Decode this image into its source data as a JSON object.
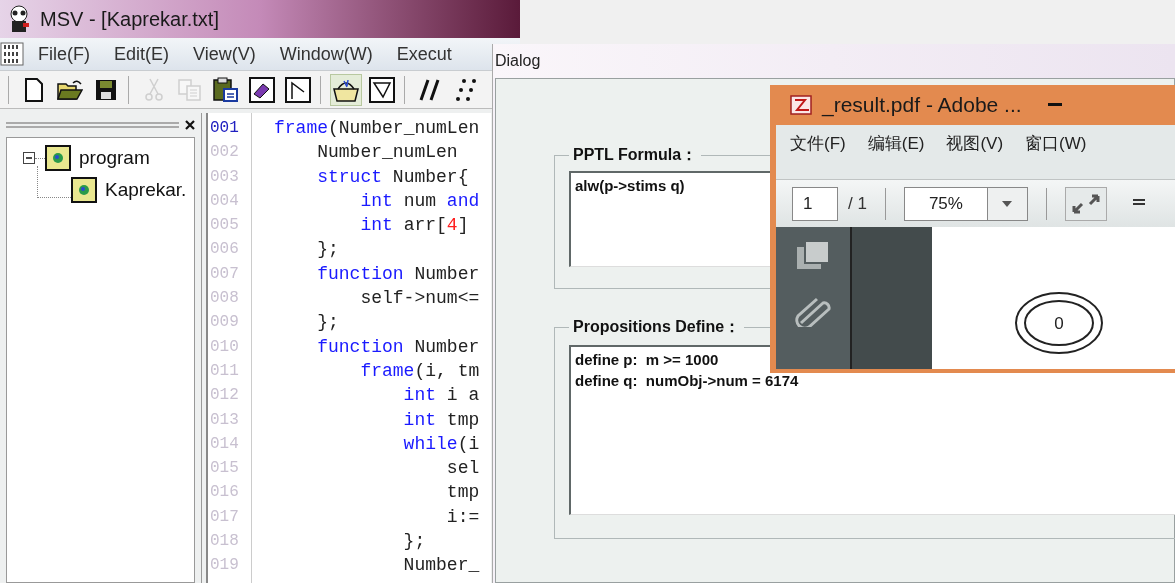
{
  "main_window": {
    "title": "MSV - [Kaprekar.txt]",
    "menu": [
      "File(F)",
      "Edit(E)",
      "View(V)",
      "Window(W)",
      "Execut"
    ],
    "toolbar": [
      [
        {
          "kind": "new",
          "disabled": false,
          "pressed": false
        },
        {
          "kind": "open",
          "disabled": false,
          "pressed": false
        },
        {
          "kind": "save",
          "disabled": false,
          "pressed": false
        }
      ],
      [
        {
          "kind": "cut",
          "disabled": true,
          "pressed": false
        },
        {
          "kind": "copy",
          "disabled": true,
          "pressed": false
        },
        {
          "kind": "paste",
          "disabled": false,
          "pressed": false
        },
        {
          "kind": "erase",
          "disabled": false,
          "pressed": false
        },
        {
          "kind": "flag",
          "disabled": false,
          "pressed": false
        }
      ],
      [
        {
          "kind": "basket",
          "disabled": false,
          "pressed": true
        },
        {
          "kind": "funnel",
          "disabled": false,
          "pressed": false
        }
      ],
      [
        {
          "kind": "slashes",
          "disabled": false,
          "pressed": false
        },
        {
          "kind": "dots",
          "disabled": false,
          "pressed": false
        }
      ]
    ],
    "tree": [
      {
        "label": "program",
        "expanded": true,
        "children": [
          {
            "label": "Kaprekar."
          }
        ]
      }
    ],
    "editor": {
      "lines": [
        {
          "number": "001",
          "current": true,
          "segments": [
            {
              "kind": "keyword",
              "text": "frame"
            },
            {
              "kind": "plain",
              "text": "(Number_numLen"
            }
          ]
        },
        {
          "number": "002",
          "current": false,
          "segments": [
            {
              "kind": "plain",
              "text": "    Number_numLen"
            }
          ]
        },
        {
          "number": "003",
          "current": false,
          "segments": [
            {
              "kind": "keyword",
              "text": "    struct"
            },
            {
              "kind": "plain",
              "text": " Number{"
            }
          ]
        },
        {
          "number": "004",
          "current": false,
          "segments": [
            {
              "kind": "keyword",
              "text": "        int"
            },
            {
              "kind": "plain",
              "text": " num "
            },
            {
              "kind": "keyword",
              "text": "and"
            }
          ]
        },
        {
          "number": "005",
          "current": false,
          "segments": [
            {
              "kind": "keyword",
              "text": "        int"
            },
            {
              "kind": "plain",
              "text": " arr["
            },
            {
              "kind": "number",
              "text": "4"
            },
            {
              "kind": "plain",
              "text": "]"
            }
          ]
        },
        {
          "number": "006",
          "current": false,
          "segments": [
            {
              "kind": "plain",
              "text": "    };"
            }
          ]
        },
        {
          "number": "007",
          "current": false,
          "segments": [
            {
              "kind": "keyword",
              "text": "    function"
            },
            {
              "kind": "plain",
              "text": " Number"
            }
          ]
        },
        {
          "number": "008",
          "current": false,
          "segments": [
            {
              "kind": "plain",
              "text": "        self->num<="
            }
          ]
        },
        {
          "number": "009",
          "current": false,
          "segments": [
            {
              "kind": "plain",
              "text": "    };"
            }
          ]
        },
        {
          "number": "010",
          "current": false,
          "segments": [
            {
              "kind": "keyword",
              "text": "    function"
            },
            {
              "kind": "plain",
              "text": " Number"
            }
          ]
        },
        {
          "number": "011",
          "current": false,
          "segments": [
            {
              "kind": "keyword",
              "text": "        frame"
            },
            {
              "kind": "plain",
              "text": "(i, tm"
            }
          ]
        },
        {
          "number": "012",
          "current": false,
          "segments": [
            {
              "kind": "keyword",
              "text": "            int"
            },
            {
              "kind": "plain",
              "text": " i a"
            }
          ]
        },
        {
          "number": "013",
          "current": false,
          "segments": [
            {
              "kind": "keyword",
              "text": "            int"
            },
            {
              "kind": "plain",
              "text": " tmp"
            }
          ]
        },
        {
          "number": "014",
          "current": false,
          "segments": [
            {
              "kind": "keyword",
              "text": "            while"
            },
            {
              "kind": "plain",
              "text": "(i"
            }
          ]
        },
        {
          "number": "015",
          "current": false,
          "segments": [
            {
              "kind": "plain",
              "text": "                sel"
            }
          ]
        },
        {
          "number": "016",
          "current": false,
          "segments": [
            {
              "kind": "plain",
              "text": "                tmp"
            }
          ]
        },
        {
          "number": "017",
          "current": false,
          "segments": [
            {
              "kind": "plain",
              "text": "                i:="
            }
          ]
        },
        {
          "number": "018",
          "current": false,
          "segments": [
            {
              "kind": "plain",
              "text": "            };"
            }
          ]
        },
        {
          "number": "019",
          "current": false,
          "segments": [
            {
              "kind": "plain",
              "text": "            Number_"
            }
          ]
        }
      ]
    }
  },
  "dialog": {
    "title": "Dialog",
    "groups": [
      {
        "label": "PPTL Formula：",
        "lines": [
          "alw(p->stims q)"
        ]
      },
      {
        "label": "Propositions Define：",
        "lines": [
          "define p:  m >= 1000",
          "define q:  numObj->num = 6174"
        ]
      }
    ]
  },
  "pdf_window": {
    "title": "_result.pdf - Adobe ...",
    "menu": [
      "文件(F)",
      "编辑(E)",
      "视图(V)",
      "窗口(W)"
    ],
    "page": "1",
    "page_count": "/ 1",
    "zoom": "75%",
    "diagram_state": "0"
  }
}
